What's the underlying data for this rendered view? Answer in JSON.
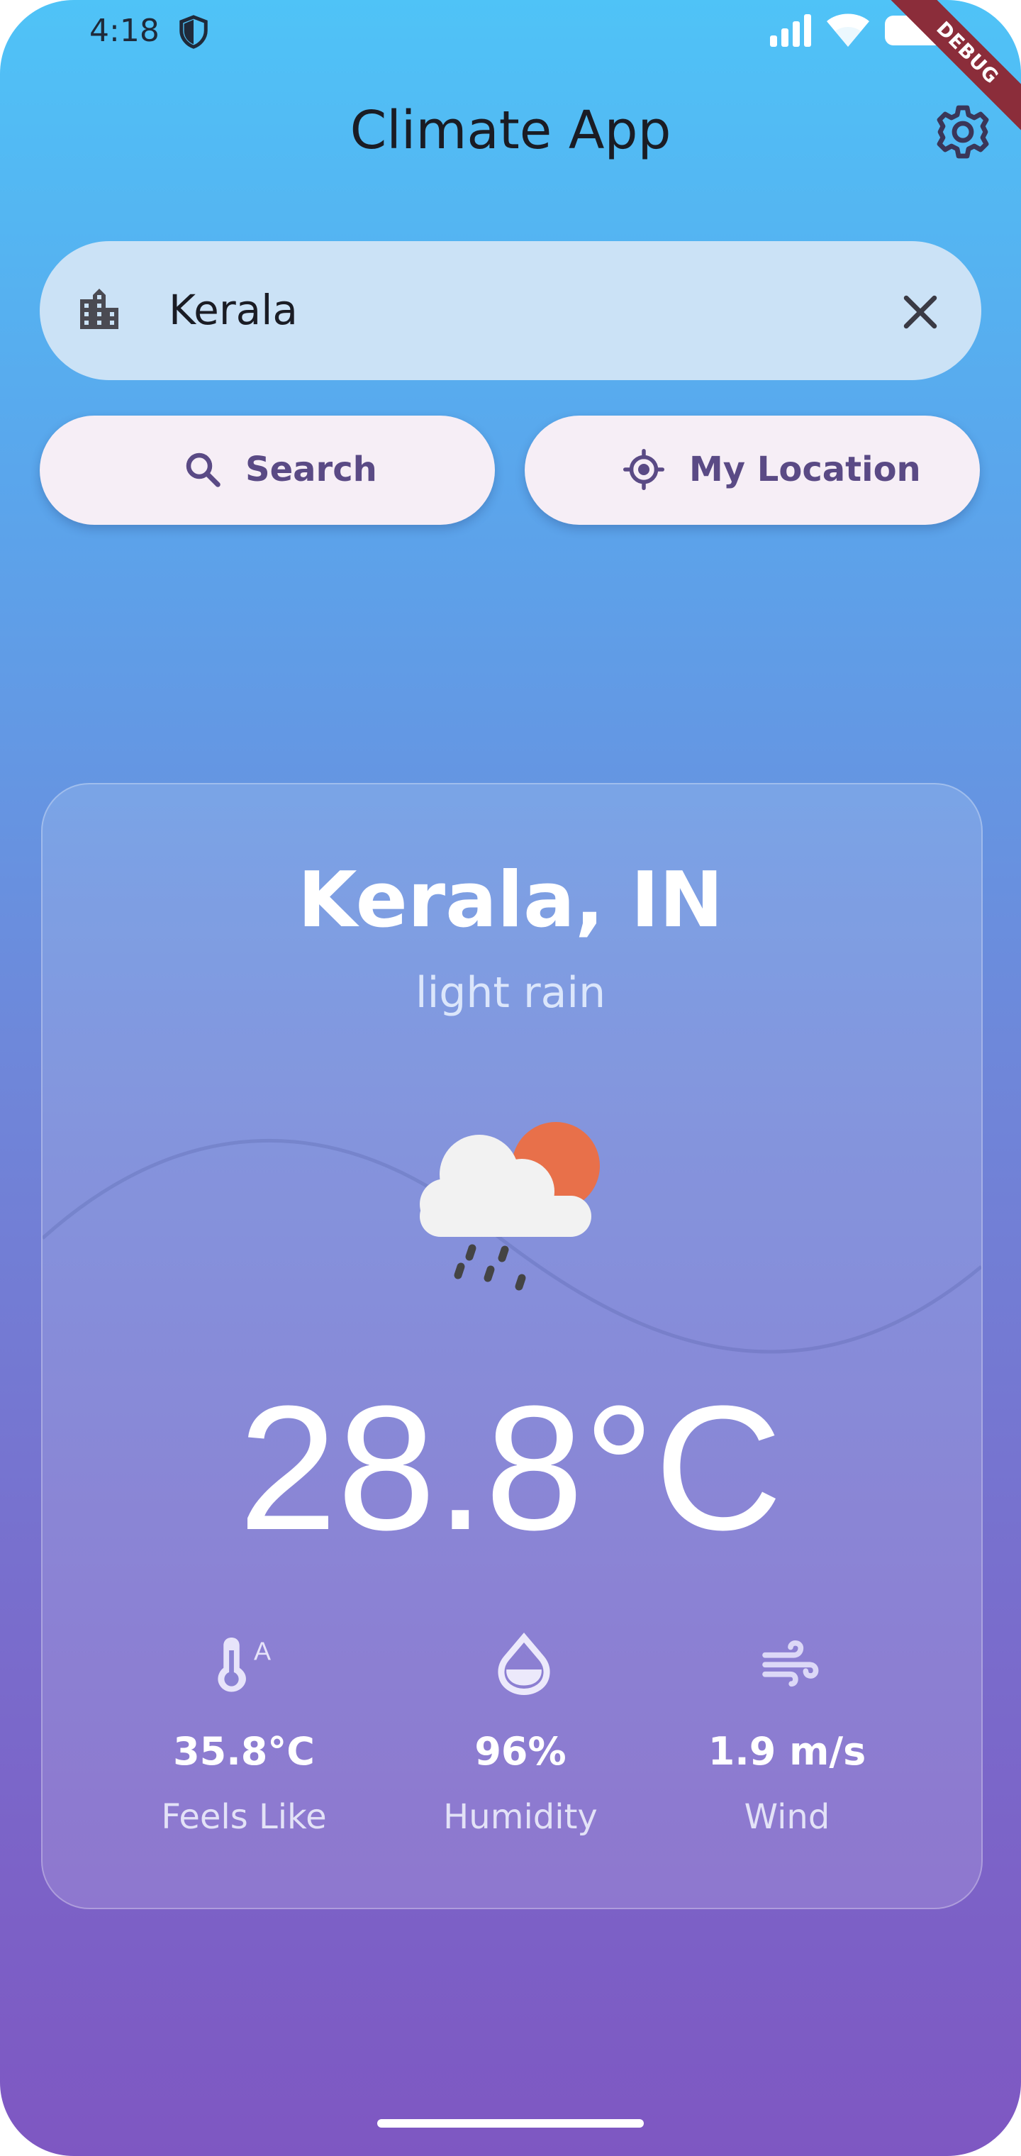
{
  "status_bar": {
    "time": "4:18",
    "debug_banner": "DEBUG"
  },
  "app_bar": {
    "title": "Climate App"
  },
  "search": {
    "value": "Kerala"
  },
  "buttons": {
    "search_label": "Search",
    "location_label": "My Location"
  },
  "weather": {
    "location": "Kerala, IN",
    "condition": "light rain",
    "temperature": "28.8°C",
    "stats": [
      {
        "value": "35.8°C",
        "label": "Feels Like",
        "icon": "thermometer-icon"
      },
      {
        "value": "96%",
        "label": "Humidity",
        "icon": "water-drop-icon"
      },
      {
        "value": "1.9 m/s",
        "label": "Wind",
        "icon": "wind-icon"
      }
    ]
  },
  "colors": {
    "gradient_top": "#4fc3f7",
    "gradient_bottom": "#7e57c2",
    "button_text": "#5a4a85",
    "sun": "#e8704a"
  }
}
